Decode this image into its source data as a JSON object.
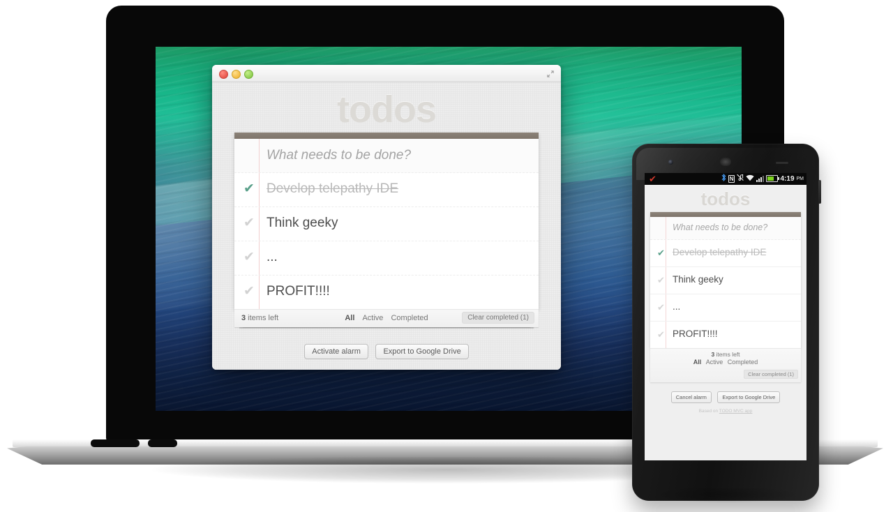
{
  "app": {
    "title": "todos",
    "new_todo_placeholder": "What needs to be done?",
    "items": [
      {
        "label": "Develop telepathy IDE",
        "completed": true,
        "check": "✔"
      },
      {
        "label": "Think geeky",
        "completed": false,
        "check": "✔"
      },
      {
        "label": "...",
        "completed": false,
        "check": "✔"
      },
      {
        "label": "PROFIT!!!!",
        "completed": false,
        "check": "✔"
      }
    ],
    "footer": {
      "count_number": "3",
      "count_text": " items left",
      "filters": [
        {
          "label": "All",
          "selected": true
        },
        {
          "label": "Active",
          "selected": false
        },
        {
          "label": "Completed",
          "selected": false
        }
      ],
      "clear_button": "Clear completed (1)"
    },
    "desktop_buttons": {
      "alarm": "Activate alarm",
      "export": "Export to Google Drive"
    },
    "phone_buttons": {
      "alarm": "Cancel alarm",
      "export": "Export to Google Drive"
    },
    "credit_prefix": "Based on ",
    "credit_link": "TODO MVC app"
  },
  "mac_window": {
    "close_label": "close",
    "minimize_label": "minimize",
    "zoom_label": "zoom",
    "fullscreen_label": "fullscreen"
  },
  "phone_status_bar": {
    "notification_check": "✔",
    "bluetooth": "ᛗ",
    "nfc": "N",
    "mute": "♪",
    "wifi": "wifi-icon",
    "signal": "signal-icon",
    "battery": "battery-icon",
    "time": "4:19",
    "ampm": "PM"
  },
  "colors": {
    "completed_check": "#5aa08a",
    "active_check": "#d2d2d2",
    "toggle_bar": "#8c8379",
    "title_gray": "#dcdad6",
    "battery_green": "#7ed321",
    "notification_red": "#d43a2e"
  }
}
